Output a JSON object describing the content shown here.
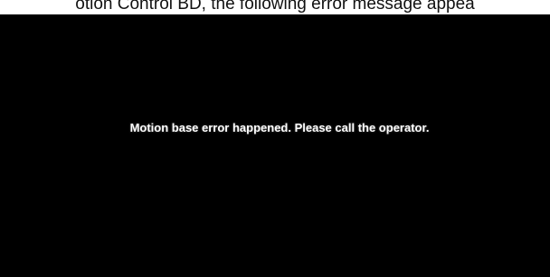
{
  "caption": {
    "text": "otion Control BD, the following error message appea"
  },
  "screen": {
    "background_color": "#000000",
    "error_message": "Motion base error happened. Please call the operator."
  }
}
